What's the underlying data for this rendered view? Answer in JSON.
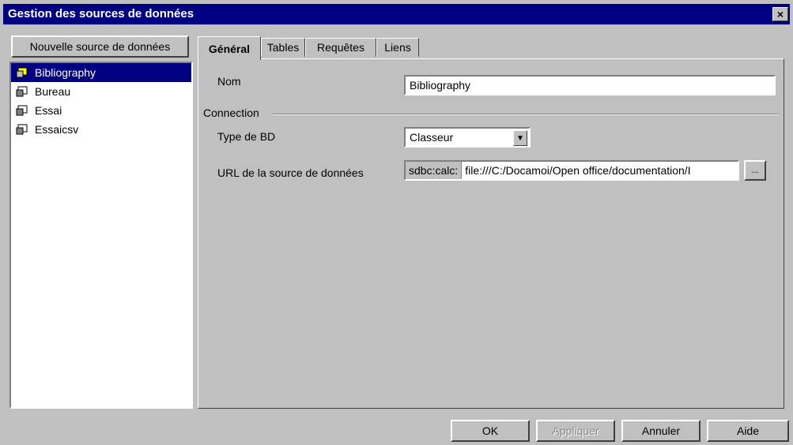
{
  "window": {
    "title": "Gestion des sources de données",
    "close_glyph": "×"
  },
  "sidebar": {
    "new_button": "Nouvelle source de données",
    "items": [
      {
        "label": "Bibliography",
        "selected": true,
        "icon": "database-icon"
      },
      {
        "label": "Bureau",
        "selected": false,
        "icon": "database-icon"
      },
      {
        "label": "Essai",
        "selected": false,
        "icon": "database-icon"
      },
      {
        "label": "Essaicsv",
        "selected": false,
        "icon": "database-icon"
      }
    ]
  },
  "tabs": [
    {
      "label": "Général",
      "active": true
    },
    {
      "label": "Tables",
      "active": false
    },
    {
      "label": "Requêtes",
      "active": false
    },
    {
      "label": "Liens",
      "active": false
    }
  ],
  "general": {
    "name_label": "Nom",
    "name_value": "Bibliography",
    "connection_label": "Connection",
    "dbtype_label": "Type de BD",
    "dbtype_value": "Classeur",
    "url_label": "URL de la source de données",
    "url_prefix": "sdbc:calc:",
    "url_value": "file:///C:/Docamoi/Open office/documentation/I",
    "browse_label": "..."
  },
  "footer": {
    "ok": "OK",
    "apply": "Appliquer",
    "cancel": "Annuler",
    "help": "Aide"
  }
}
